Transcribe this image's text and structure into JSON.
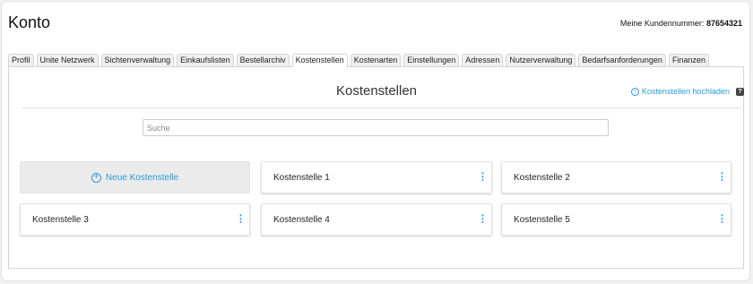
{
  "header": {
    "title": "Konto",
    "customer_label": "Meine Kundennummer:",
    "customer_number": "87654321"
  },
  "tabs": [
    {
      "label": "Profil"
    },
    {
      "label": "Unite Netzwerk"
    },
    {
      "label": "Sichtenverwaltung"
    },
    {
      "label": "Einkaufslisten"
    },
    {
      "label": "Bestellarchiv"
    },
    {
      "label": "Kostenstellen",
      "active": true
    },
    {
      "label": "Kostenarten"
    },
    {
      "label": "Einstellungen"
    },
    {
      "label": "Adressen"
    },
    {
      "label": "Nutzerverwaltung"
    },
    {
      "label": "Bedarfsanforderungen"
    },
    {
      "label": "Finanzen"
    }
  ],
  "main": {
    "title": "Kostenstellen",
    "upload_label": "Kostenstellen hochladen",
    "help_label": "?",
    "search_placeholder": "Suche",
    "new_label": "Neue Kostenstelle",
    "cards": [
      "Kostenstelle 1",
      "Kostenstelle 2",
      "Kostenstelle 3",
      "Kostenstelle 4",
      "Kostenstelle 5"
    ]
  },
  "colors": {
    "accent": "#2a9ad6"
  },
  "icons": {
    "upload": "upload-circle-icon",
    "plus": "plus-circle-icon",
    "more": "more-vertical-icon"
  }
}
